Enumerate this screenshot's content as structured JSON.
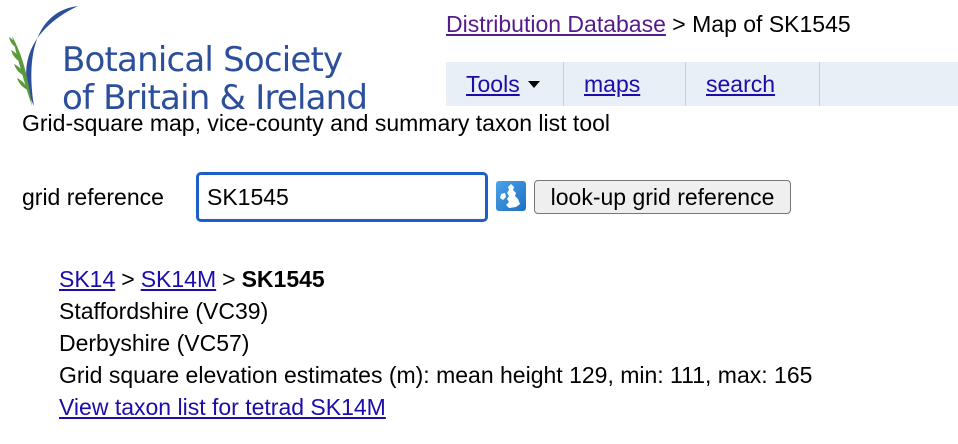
{
  "logo": {
    "line1": "Botanical Society",
    "line2": "of Britain & Ireland"
  },
  "breadcrumb": {
    "link": "Distribution Database",
    "separator": ">",
    "current": "Map of SK1545"
  },
  "nav": {
    "tools": "Tools",
    "maps": "maps",
    "search": "search"
  },
  "subtitle": "Grid-square map, vice-county and summary taxon list tool",
  "grid_form": {
    "label": "grid reference",
    "value": "SK1545",
    "button": "look-up grid reference"
  },
  "hierarchy": {
    "level1": "SK14",
    "sep": ">",
    "level2": "SK14M",
    "current": "SK1545"
  },
  "vice_counties": [
    "Staffordshire (VC39)",
    "Derbyshire (VC57)"
  ],
  "elevation": "Grid square elevation estimates (m): mean height 129, min: 111, max: 165",
  "taxon_link": "View taxon list for tetrad SK14M",
  "colors": {
    "logo_blue": "#2b4f9c",
    "logo_green": "#5b9a3c",
    "link": "#1a0dab",
    "visited_link": "#551a8b",
    "tab_bg": "#e8eff7",
    "input_border": "#1c5fc9"
  }
}
